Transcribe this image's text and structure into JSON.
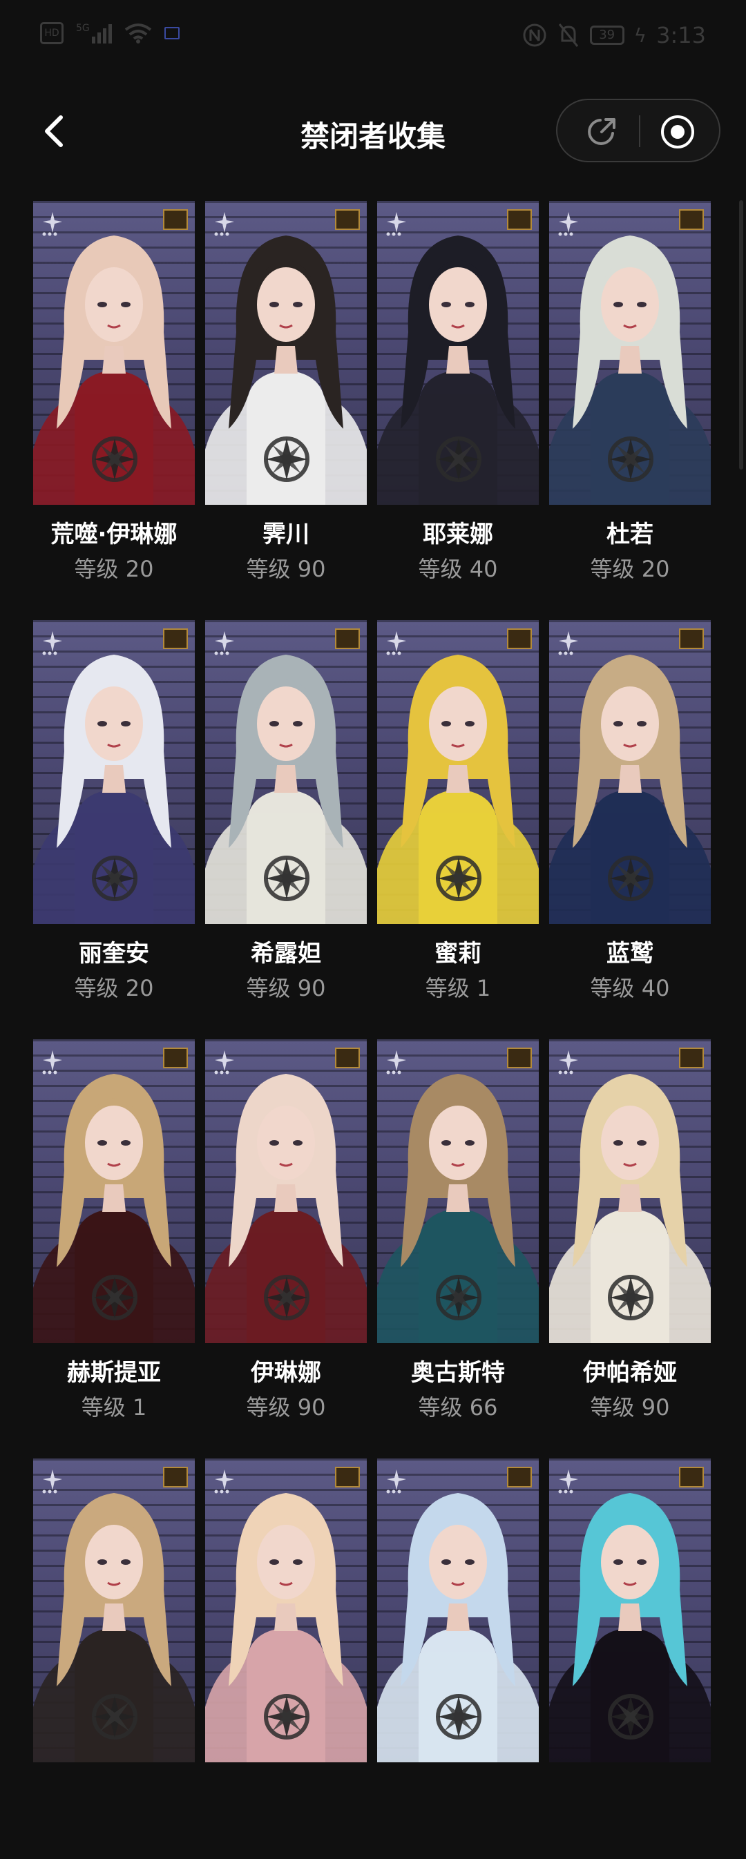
{
  "status_bar": {
    "icons": [
      "hd-icon",
      "signal-5g-icon",
      "wifi-icon",
      "screen-record-icon",
      "nfc-icon",
      "mute-icon"
    ],
    "network": "5G",
    "battery": "39",
    "time": "3:13"
  },
  "header": {
    "title": "禁闭者收集",
    "back_icon": "chevron-left-icon",
    "share_icon": "share-icon",
    "target_icon": "target-icon"
  },
  "characters": [
    {
      "name": "荒噬·伊琳娜",
      "level": "等级 20",
      "hair": "#e8c9b8",
      "outfit": "#8a1a24"
    },
    {
      "name": "霁川",
      "level": "等级 90",
      "hair": "#2a2422",
      "outfit": "#ececec"
    },
    {
      "name": "耶莱娜",
      "level": "等级 40",
      "hair": "#1d1d26",
      "outfit": "#23222e"
    },
    {
      "name": "杜若",
      "level": "等级 20",
      "hair": "#d9ddd6",
      "outfit": "#2b3c5a"
    },
    {
      "name": "丽奎安",
      "level": "等级 20",
      "hair": "#e6e8f0",
      "outfit": "#3c3a70"
    },
    {
      "name": "希露妲",
      "level": "等级 90",
      "hair": "#a9b3b7",
      "outfit": "#e6e4dc"
    },
    {
      "name": "蜜莉",
      "level": "等级 1",
      "hair": "#e5c33e",
      "outfit": "#e8cf3a"
    },
    {
      "name": "蓝鹫",
      "level": "等级 40",
      "hair": "#c7ac85",
      "outfit": "#1f2e55"
    },
    {
      "name": "赫斯提亚",
      "level": "等级 1",
      "hair": "#c8a777",
      "outfit": "#3a1416"
    },
    {
      "name": "伊琳娜",
      "level": "等级 90",
      "hair": "#edd6c9",
      "outfit": "#6b1c22"
    },
    {
      "name": "奥古斯特",
      "level": "等级 66",
      "hair": "#a88a64",
      "outfit": "#1e5560"
    },
    {
      "name": "伊帕希娅",
      "level": "等级 90",
      "hair": "#e6d2a9",
      "outfit": "#ebe6da"
    },
    {
      "name": "",
      "level": "",
      "hair": "#caa97e",
      "outfit": "#2a2322"
    },
    {
      "name": "",
      "level": "",
      "hair": "#efd3b7",
      "outfit": "#d7a4a9"
    },
    {
      "name": "",
      "level": "",
      "hair": "#c4d8ec",
      "outfit": "#d8e4f0"
    },
    {
      "name": "",
      "level": "",
      "hair": "#56c6d6",
      "outfit": "#141018"
    }
  ]
}
